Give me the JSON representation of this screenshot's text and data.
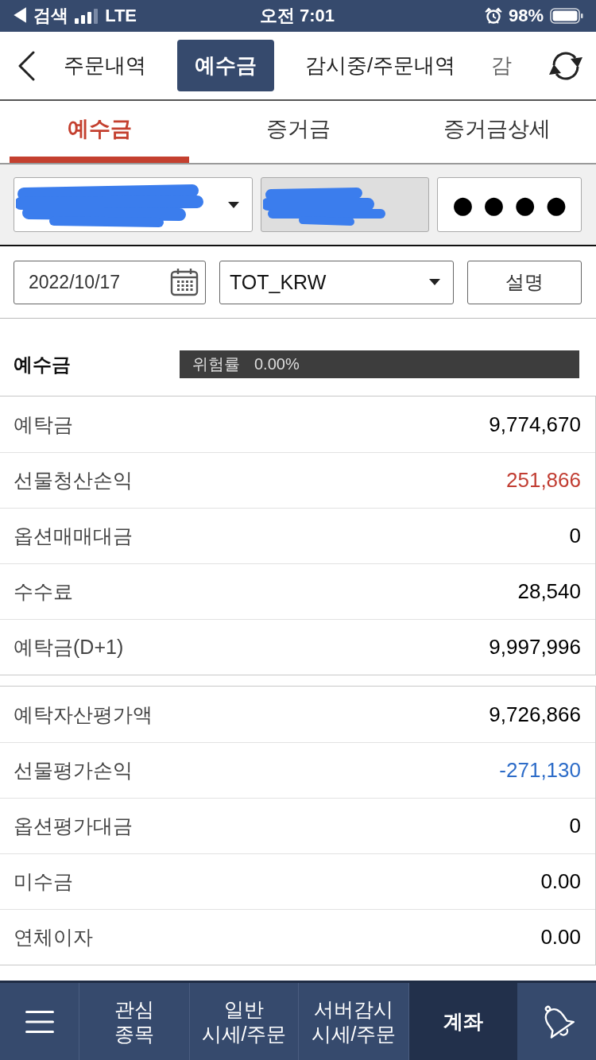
{
  "status_bar": {
    "back_label": "◀ 검색",
    "network": "LTE",
    "time": "오전 7:01",
    "battery": "98%"
  },
  "top_tabs": [
    {
      "label": "주문내역",
      "selected": false
    },
    {
      "label": "예수금",
      "selected": true
    },
    {
      "label": "감시중/주문내역",
      "selected": false
    },
    {
      "label": "감",
      "selected": false
    }
  ],
  "sub_tabs": [
    {
      "label": "예수금",
      "selected": true
    },
    {
      "label": "증거금",
      "selected": false
    },
    {
      "label": "증거금상세",
      "selected": false
    }
  ],
  "account": {
    "password": "●●●●"
  },
  "filters": {
    "date": "2022/10/17",
    "currency": "TOT_KRW",
    "help_button": "설명"
  },
  "summary": {
    "title": "예수금",
    "risk_label": "위험률",
    "risk_value": "0.00%"
  },
  "groups": [
    {
      "rows": [
        {
          "label": "예탁금",
          "value": "9,774,670",
          "color": "#000000"
        },
        {
          "label": "선물청산손익",
          "value": "251,866",
          "color": "#c13d32"
        },
        {
          "label": "옵션매매대금",
          "value": "0",
          "color": "#000000"
        },
        {
          "label": "수수료",
          "value": "28,540",
          "color": "#000000"
        },
        {
          "label": "예탁금(D+1)",
          "value": "9,997,996",
          "color": "#000000"
        }
      ]
    },
    {
      "rows": [
        {
          "label": "예탁자산평가액",
          "value": "9,726,866",
          "color": "#000000"
        },
        {
          "label": "선물평가손익",
          "value": "-271,130",
          "color": "#2d6cc8"
        },
        {
          "label": "옵션평가대금",
          "value": "0",
          "color": "#000000"
        },
        {
          "label": "미수금",
          "value": "0.00",
          "color": "#000000"
        },
        {
          "label": "연체이자",
          "value": "0.00",
          "color": "#000000"
        }
      ]
    }
  ],
  "bottom_nav": {
    "items": [
      {
        "lines": [
          "관심",
          "종목"
        ],
        "selected": false
      },
      {
        "lines": [
          "일반",
          "시세/주문"
        ],
        "selected": false
      },
      {
        "lines": [
          "서버감시",
          "시세/주문"
        ],
        "selected": false
      },
      {
        "lines": [
          "계좌"
        ],
        "selected": true
      }
    ]
  }
}
